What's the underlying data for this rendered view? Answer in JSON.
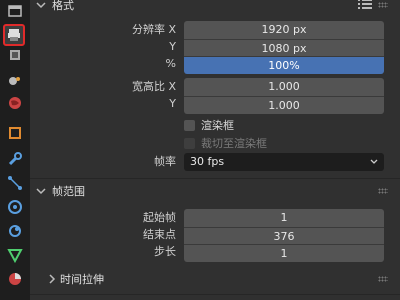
{
  "format_panel": {
    "title": "格式",
    "resolution_x_label": "分辨率 X",
    "resolution_x_value": "1920 px",
    "resolution_y_label": "Y",
    "resolution_y_value": "1080 px",
    "percent_label": "%",
    "percent_value": "100%",
    "aspect_x_label": "宽高比 X",
    "aspect_x_value": "1.000",
    "aspect_y_label": "Y",
    "aspect_y_value": "1.000",
    "render_region_label": "渲染框",
    "crop_to_region_label": "裁切至渲染框",
    "frame_rate_label": "帧率",
    "frame_rate_value": "30 fps"
  },
  "frame_range_panel": {
    "title": "帧范围",
    "frame_start_label": "起始帧",
    "frame_start_value": "1",
    "frame_end_label": "结束点",
    "frame_end_value": "376",
    "frame_step_label": "步长",
    "frame_step_value": "1"
  },
  "time_stretch_panel": {
    "title": "时间拉伸"
  },
  "tabs": [
    {
      "icon": "tool-icon"
    },
    {
      "icon": "render-icon"
    },
    {
      "icon": "output-icon"
    },
    {
      "icon": "view-layer-icon"
    },
    {
      "icon": "scene-icon"
    },
    {
      "icon": "world-icon"
    },
    {
      "icon": "object-icon"
    },
    {
      "icon": "modifier-wrench-icon"
    },
    {
      "icon": "particles-icon"
    },
    {
      "icon": "physics-icon"
    },
    {
      "icon": "constraints-icon"
    },
    {
      "icon": "object-data-icon"
    },
    {
      "icon": "material-icon"
    }
  ],
  "colors": {
    "accent_blue": "#4772b3",
    "active_tab_outline": "#e02a2a"
  }
}
